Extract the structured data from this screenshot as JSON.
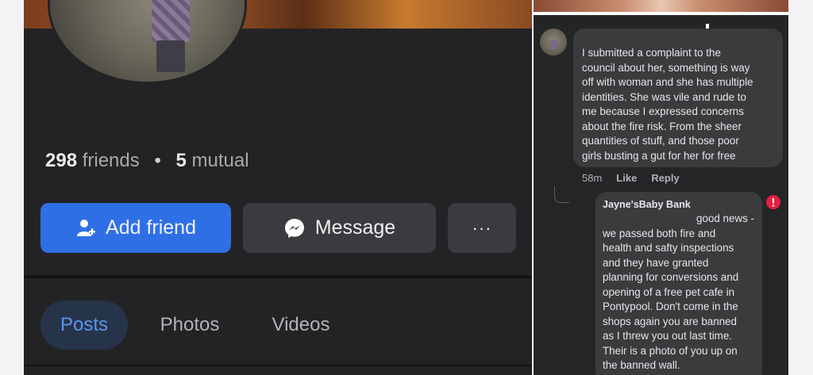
{
  "profile": {
    "friends_count": "298",
    "friends_label": "friends",
    "separator": "•",
    "mutual_count": "5",
    "mutual_label": "mutual",
    "actions": {
      "add_friend": "Add friend",
      "message": "Message",
      "more": "···"
    },
    "tabs": [
      {
        "label": "Posts",
        "active": true
      },
      {
        "label": "Photos",
        "active": false
      },
      {
        "label": "Videos",
        "active": false
      }
    ],
    "colors": {
      "primary_button": "#2f6fe6",
      "active_tab_text": "#5b95ee",
      "background": "#232325"
    }
  },
  "comments": {
    "main_comment": {
      "lines": [
        "I submitted a complaint to the",
        "council about her, something is way",
        "off with woman and she has multiple",
        "identities. She was vile and rude to",
        "me because I expressed concerns",
        "about the fire risk.  From the sheer",
        "quantities of stuff, and those poor",
        "girls busting a gut for her for free"
      ],
      "time": "58m",
      "like": "Like",
      "reply": "Reply"
    },
    "reply": {
      "author": "Jayne'sBaby Bank",
      "lines": [
        "good news -",
        "we passed both fire and",
        "health and safty inspections",
        "and they have granted",
        "planning for conversions and",
        "opening of a free pet cafe in",
        "Pontypool.  Don't come in the",
        "shops again you are banned",
        "as I threw you out last time.",
        "Their is a photo of you up on",
        "the banned wall."
      ],
      "alert_color": "#e41e3f"
    }
  }
}
